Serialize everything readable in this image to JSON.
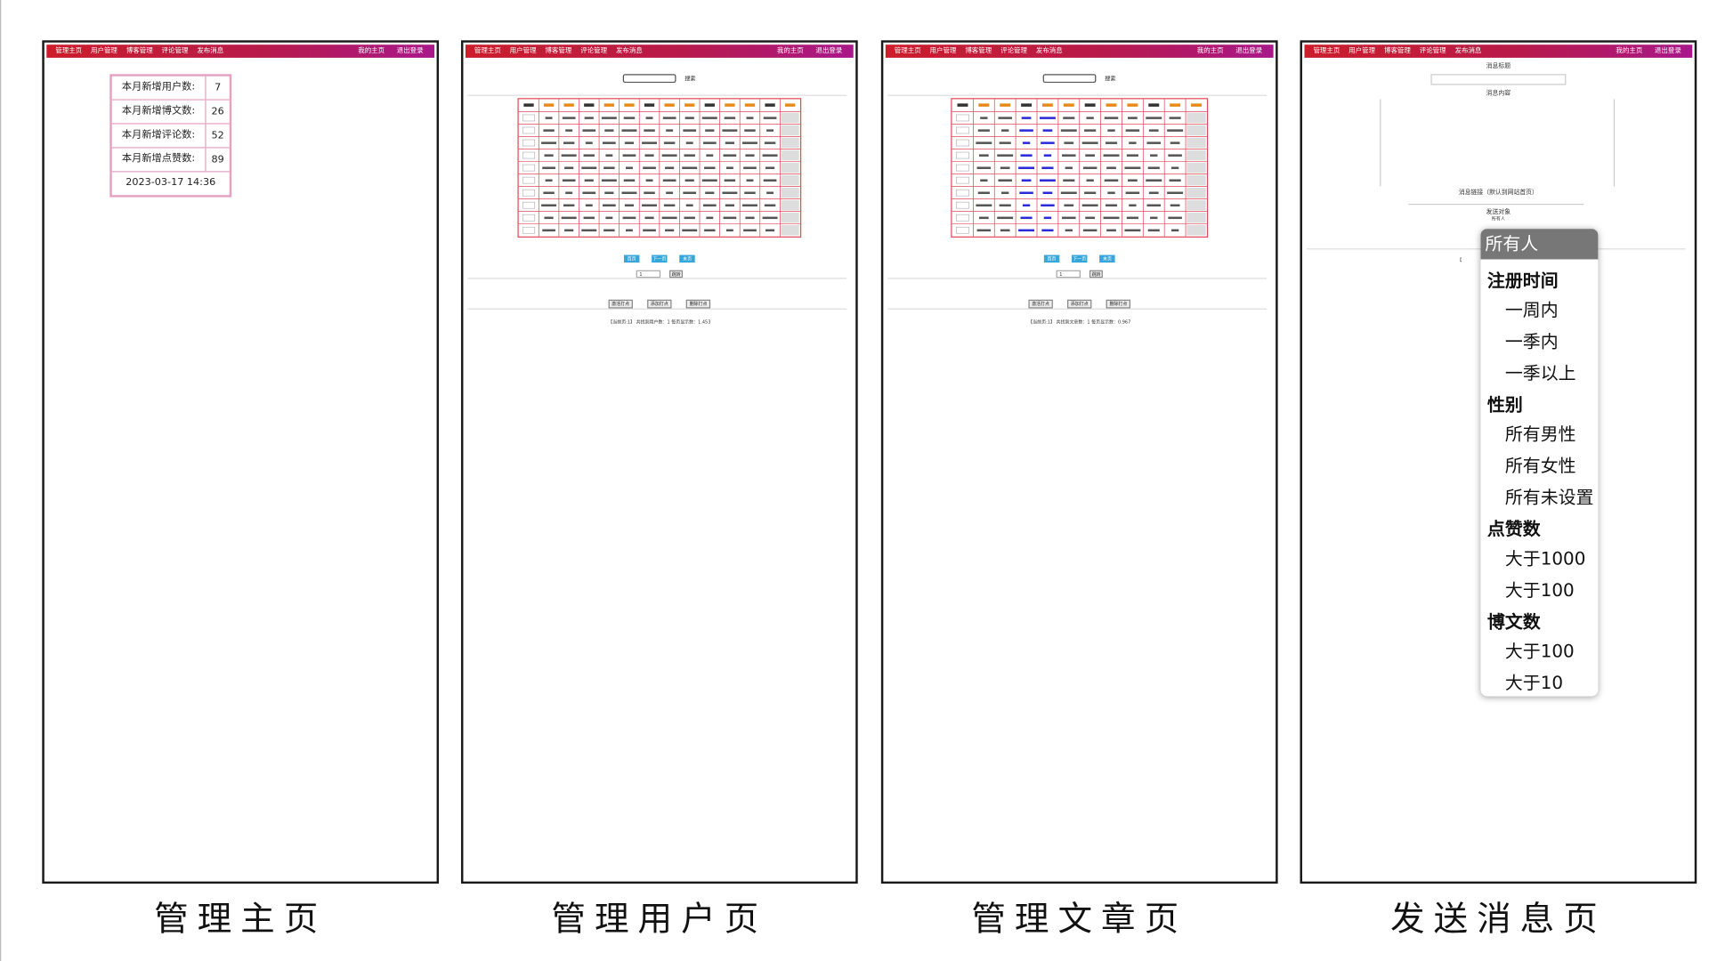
{
  "nav": {
    "left": [
      "管理主页",
      "用户管理",
      "博客管理",
      "评论管理",
      "发布消息"
    ],
    "right": [
      "我的主页",
      "退出登录"
    ]
  },
  "panels": [
    {
      "caption": "管理主页"
    },
    {
      "caption": "管理用户页"
    },
    {
      "caption": "管理文章页"
    },
    {
      "caption": "发送消息页"
    }
  ],
  "dashboard": {
    "stats": [
      {
        "label": "本月新增用户数:",
        "value": "7"
      },
      {
        "label": "本月新增博文数:",
        "value": "26"
      },
      {
        "label": "本月新增评论数:",
        "value": "52"
      },
      {
        "label": "本月新增点赞数:",
        "value": "89"
      }
    ],
    "datetime": "2023-03-17 14:36"
  },
  "user_page": {
    "search_button": "搜索",
    "pager": {
      "first": "首页",
      "next": "下一页",
      "last": "末页",
      "page": "1",
      "go": "跳转"
    },
    "actions": [
      "激活打点",
      "添加打点",
      "删除打点"
    ],
    "footer": "【当前页:1】 共找到用户数：1 每页显示数：1.453"
  },
  "article_page": {
    "search_button": "搜索",
    "pager": {
      "first": "首页",
      "next": "下一页",
      "last": "末页",
      "page": "1",
      "go": "跳转"
    },
    "actions": [
      "激活打点",
      "添加打点",
      "删除打点"
    ],
    "footer": "【当前页:1】 共找到文章数：1 每页显示数：0.967"
  },
  "message_page": {
    "title_label": "消息标题",
    "content_label": "消息内容",
    "link_label": "消息链接（默认到网站首页）",
    "target_label": "发送对象",
    "target_value": "所有人",
    "dropdown": {
      "selected": "所有人",
      "groups": [
        {
          "label": "注册时间",
          "options": [
            "一周内",
            "一季内",
            "一季以上"
          ]
        },
        {
          "label": "性别",
          "options": [
            "所有男性",
            "所有女性",
            "所有未设置"
          ]
        },
        {
          "label": "点赞数",
          "options": [
            "大于1000",
            "大于100"
          ]
        },
        {
          "label": "博文数",
          "options": [
            "大于100",
            "大于10"
          ]
        }
      ]
    }
  }
}
